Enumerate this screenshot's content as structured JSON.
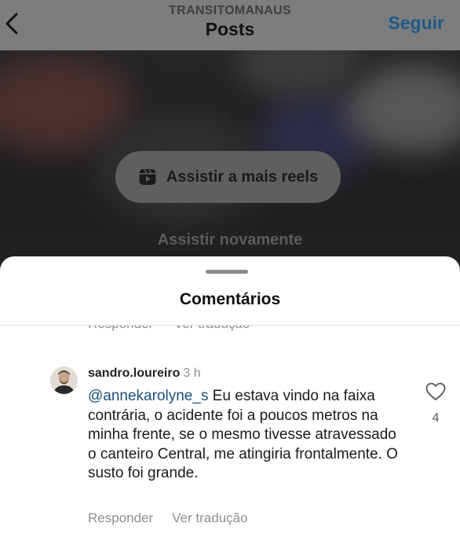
{
  "header": {
    "account": "TRANSITOMANAUS",
    "title": "Posts",
    "follow_label": "Seguir"
  },
  "video": {
    "reels_button_label": "Assistir a mais reels",
    "replay_label": "Assistir novamente"
  },
  "comments_sheet": {
    "title": "Comentários",
    "previous_actions": [
      "Responder",
      "Ver tradução"
    ],
    "comment": {
      "username": "sandro.loureiro",
      "time": "3 h",
      "mention": "@annekarolyne_s",
      "text": " Eu estava vindo na faixa contrária, o acidente foi a poucos metros na minha frente,  se o mesmo tivesse atravessado o canteiro Central, me atingiria frontalmente. O susto foi grande.",
      "likes": "4",
      "reply_label": "Responder",
      "translate_label": "Ver tradução"
    }
  },
  "colors": {
    "link": "#1c4f7c",
    "follow": "#1d5a8a",
    "secondary_text": "#8e8e8e"
  },
  "icons": [
    "chevron-left-icon",
    "reels-icon",
    "heart-outline-icon"
  ]
}
